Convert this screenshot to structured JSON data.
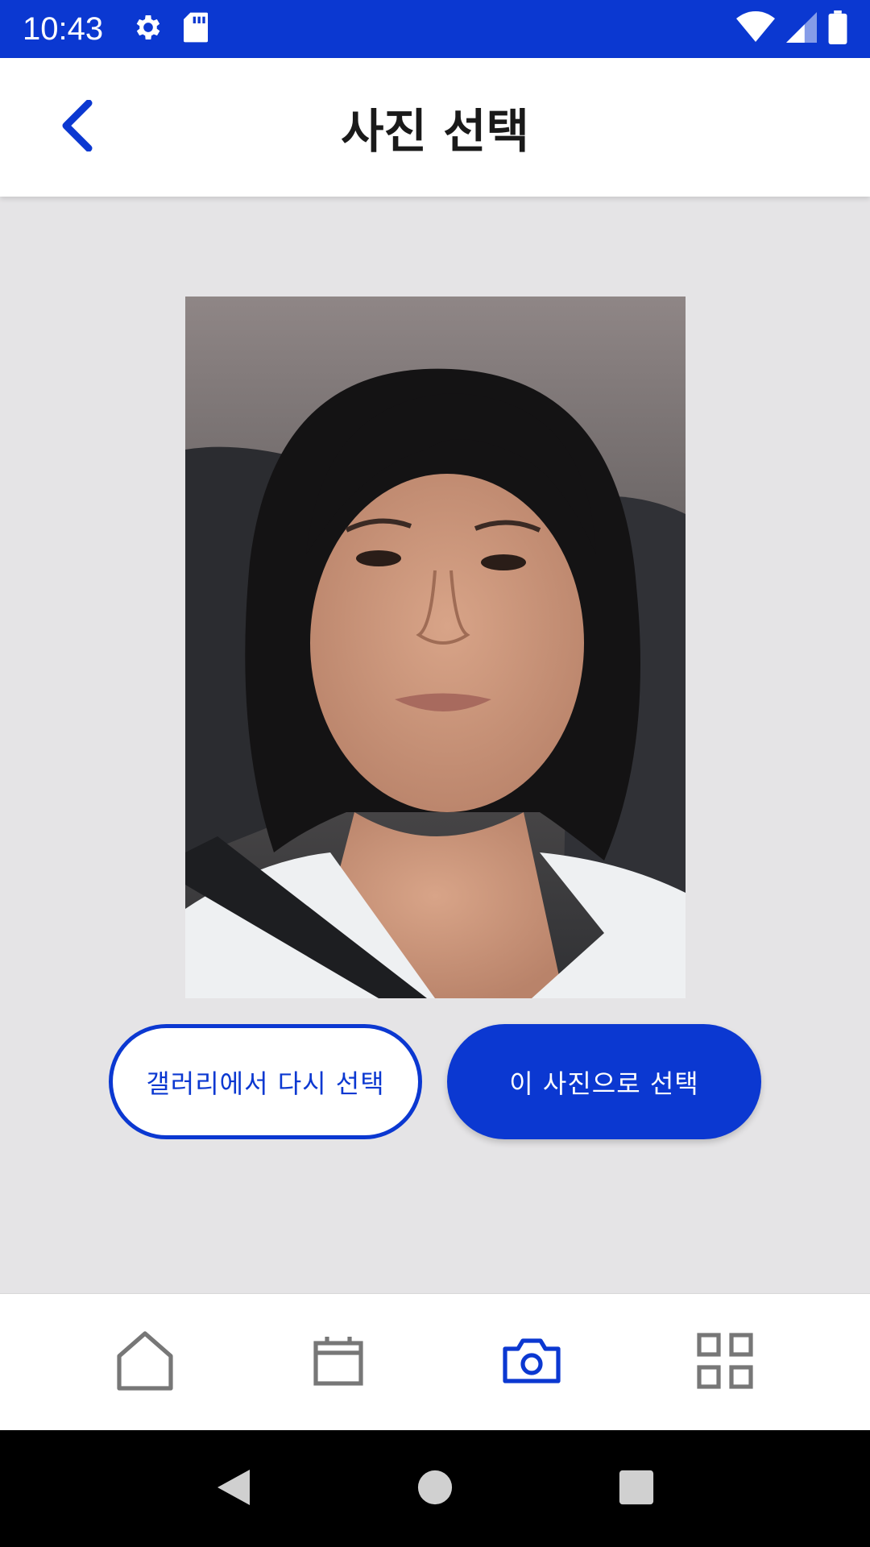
{
  "status_bar": {
    "time": "10:43",
    "icons": [
      "gear-icon",
      "sd-card-icon",
      "wifi-icon",
      "signal-icon",
      "battery-icon"
    ]
  },
  "app_bar": {
    "title": "사진 선택",
    "back_icon": "chevron-left-icon"
  },
  "photo": {
    "description_icon": "selected-photo"
  },
  "actions": {
    "reselect_label": "갤러리에서 다시 선택",
    "confirm_label": "이 사진으로 선택"
  },
  "bottom_nav": {
    "items": [
      {
        "icon": "home-icon",
        "active": false
      },
      {
        "icon": "calendar-icon",
        "active": false
      },
      {
        "icon": "camera-icon",
        "active": true
      },
      {
        "icon": "grid-icon",
        "active": false
      }
    ]
  },
  "colors": {
    "accent": "#0b38d1",
    "background": "#e5e4e6",
    "nav_inactive": "#777777"
  }
}
